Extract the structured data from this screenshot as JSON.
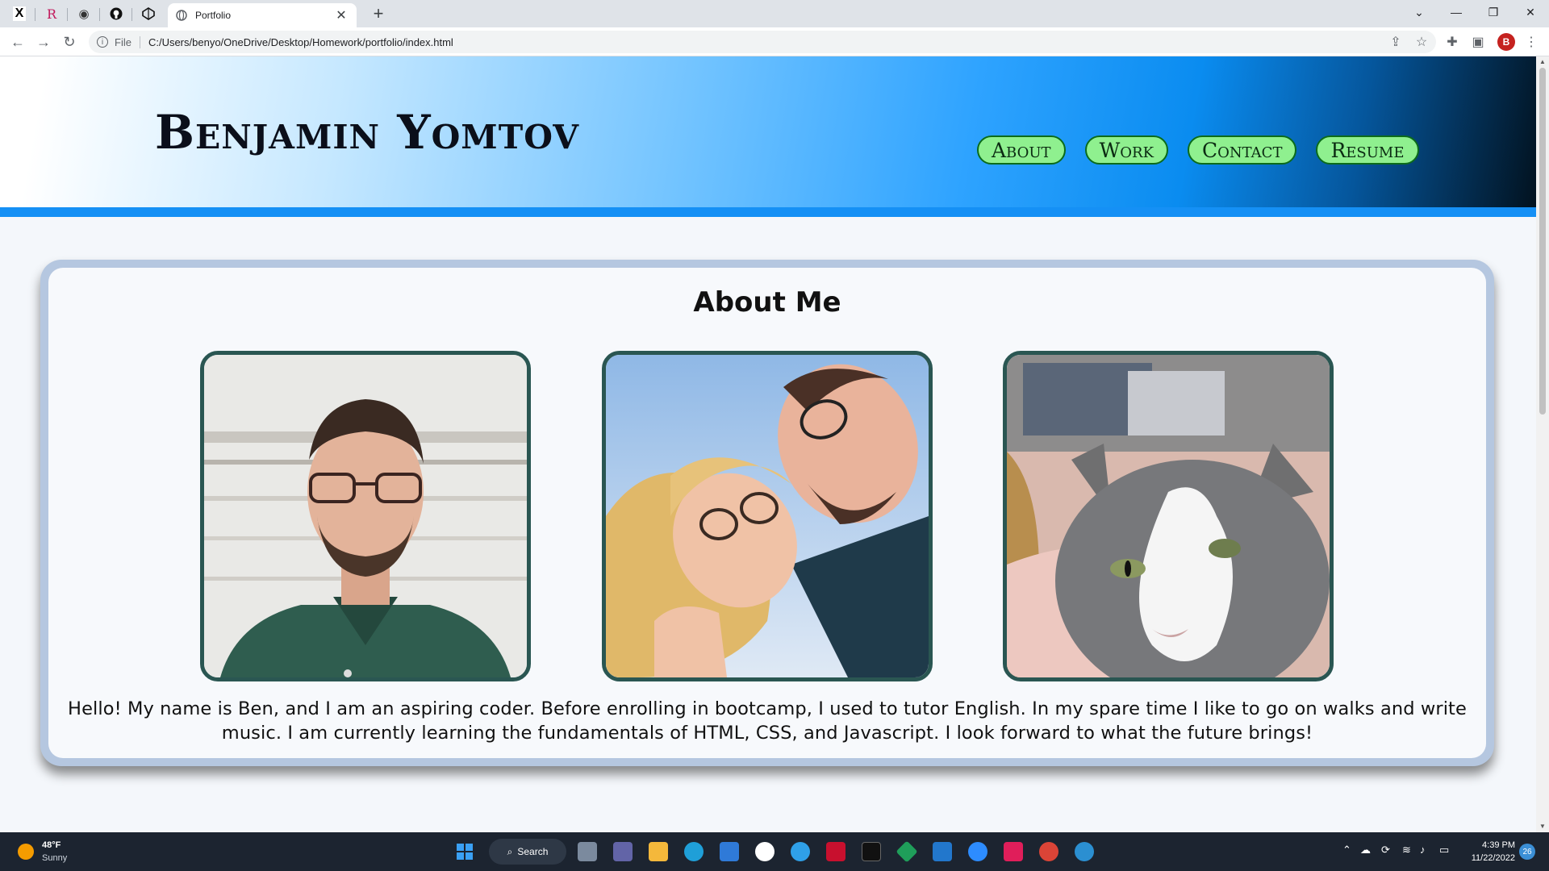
{
  "browser": {
    "pinned_tabs": [
      {
        "icon": "x-icon",
        "glyph": "X"
      },
      {
        "icon": "r-icon",
        "glyph": "R"
      },
      {
        "icon": "globe-icon",
        "glyph": "◉"
      },
      {
        "icon": "github-icon",
        "glyph": "●"
      },
      {
        "icon": "codepen-icon",
        "glyph": "◈"
      }
    ],
    "active_tab_title": "Portfolio",
    "new_tab_glyph": "+",
    "close_glyph": "✕",
    "window_controls": [
      "⌄",
      "—",
      "❐",
      "✕"
    ],
    "omnibox_label": "File",
    "url": "C:/Users/benyo/OneDrive/Desktop/Homework/portfolio/index.html",
    "profile_initial": "B"
  },
  "site": {
    "title": "Benjamin Yomtov",
    "nav": [
      "About",
      "Work",
      "Contact",
      "Resume"
    ]
  },
  "about": {
    "heading": "About Me",
    "photos": [
      {
        "icon": "portrait-photo",
        "alt": "Portrait of Ben"
      },
      {
        "icon": "couple-selfie-photo",
        "alt": "Selfie of Ben with partner"
      },
      {
        "icon": "cat-photo",
        "alt": "Grey and white cat"
      }
    ],
    "text": "Hello! My name is Ben, and I am an aspiring coder. Before enrolling in bootcamp, I used to tutor English. In my spare time I like to go on walks and write music. I am currently learning the fundamentals of HTML, CSS, and Javascript. I look forward to what the future brings!"
  },
  "taskbar": {
    "weather_temp": "48°F",
    "weather_condition": "Sunny",
    "search_label": "Search",
    "time": "4:39 PM",
    "date": "11/22/2022",
    "notification_count": "26"
  },
  "colors": {
    "nav_pill": "#8ff08f",
    "photo_border": "#2a5652",
    "card_border": "#b5c7e0",
    "hero_stripe": "#1590f5"
  }
}
